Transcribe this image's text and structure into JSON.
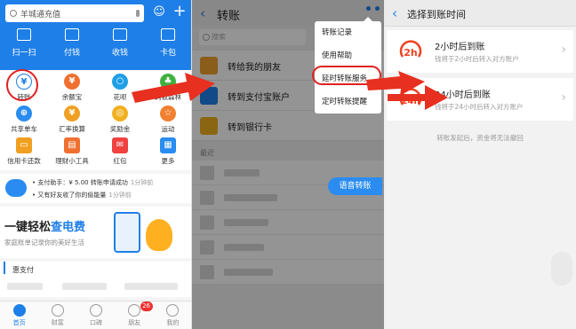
{
  "colors": {
    "alipay_blue": "#1f7fe8",
    "annotation_red": "#e02020"
  },
  "p1": {
    "search_text": "羊城通充值",
    "quick": [
      {
        "label": "扫一扫",
        "icon": "scan-icon"
      },
      {
        "label": "付钱",
        "icon": "pay-icon"
      },
      {
        "label": "收钱",
        "icon": "receive-icon"
      },
      {
        "label": "卡包",
        "icon": "card-bag-icon"
      }
    ],
    "grid": [
      {
        "label": "转账",
        "icon": "transfer-icon"
      },
      {
        "label": "余额宝",
        "icon": "yuebao-icon"
      },
      {
        "label": "花呗",
        "icon": "huabei-icon"
      },
      {
        "label": "蚂蚁森林",
        "icon": "ant-forest-icon"
      },
      {
        "label": "共享单车",
        "icon": "bike-icon"
      },
      {
        "label": "汇率换算",
        "icon": "exchange-icon"
      },
      {
        "label": "奖励金",
        "icon": "reward-icon"
      },
      {
        "label": "运动",
        "icon": "sport-icon"
      },
      {
        "label": "信用卡还款",
        "icon": "credit-card-icon"
      },
      {
        "label": "理财小工具",
        "icon": "finance-tool-icon"
      },
      {
        "label": "红包",
        "icon": "red-packet-icon"
      },
      {
        "label": "更多",
        "icon": "more-icon"
      }
    ],
    "notice_line1": "• 支付助手：¥ 5.00 转账申请成功",
    "notice_time1": "1分钟前",
    "notice_line2": "• 又有好友收了你的偷能量",
    "notice_time2": "1分钟前",
    "banner_title_part1": "一键轻松",
    "banner_title_part2": "查电费",
    "banner_sub": "家庭账单记录你的美好生活",
    "section_title": "惠支付",
    "tabs": [
      {
        "label": "首页",
        "active": true
      },
      {
        "label": "财富",
        "active": false
      },
      {
        "label": "口碑",
        "active": false
      },
      {
        "label": "朋友",
        "active": false,
        "badge": "26"
      },
      {
        "label": "我的",
        "active": false
      }
    ]
  },
  "p2": {
    "title": "转账",
    "more_dots": "•••",
    "search_placeholder": "搜索",
    "rows": [
      {
        "label": "转给我的朋友",
        "icon": "friend-icon",
        "color": "#f0a030"
      },
      {
        "label": "转到支付宝账户",
        "icon": "alipay-account-icon",
        "color": "#1f7fe8"
      },
      {
        "label": "转到银行卡",
        "icon": "bank-card-icon",
        "color": "#f0b020"
      }
    ],
    "recent_label": "最近",
    "voice_button": "语音转账",
    "menu": [
      "转账记录",
      "使用帮助",
      "延时转账服务",
      "定时转账提醒"
    ]
  },
  "p3": {
    "title": "选择到账时间",
    "options": [
      {
        "icon_text": "2h",
        "title": "2小时后到账",
        "sub": "钱将于2小时后转入对方账户"
      },
      {
        "icon_text": "24h",
        "title": "24小时后到账",
        "sub": "钱将于24小时后转入对方账户"
      }
    ],
    "footer": "转账发起后，资金将无法撤回"
  }
}
